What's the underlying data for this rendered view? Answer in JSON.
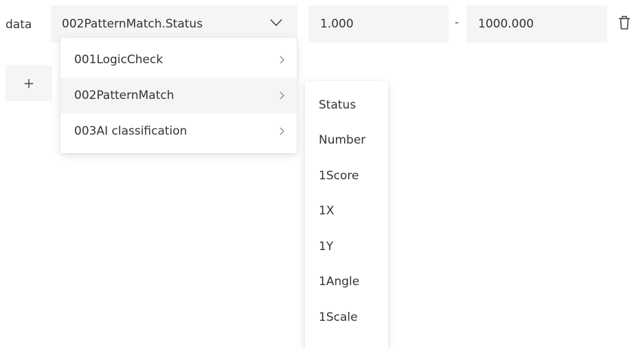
{
  "row": {
    "label": "data"
  },
  "select": {
    "value": "002PatternMatch.Status"
  },
  "range": {
    "min": "1.000",
    "separator": "-",
    "max": "1000.000"
  },
  "add_button": {
    "label": "+"
  },
  "menu": {
    "items": [
      {
        "label": "001LogicCheck"
      },
      {
        "label": "002PatternMatch"
      },
      {
        "label": "003AI classification"
      }
    ],
    "active_index": 1
  },
  "submenu": {
    "items": [
      {
        "label": "Status"
      },
      {
        "label": "Number"
      },
      {
        "label": "1Score"
      },
      {
        "label": "1X"
      },
      {
        "label": "1Y"
      },
      {
        "label": "1Angle"
      },
      {
        "label": "1Scale"
      }
    ]
  },
  "icons": {
    "select_chevron": "chevron-down-icon",
    "menu_arrow": "chevron-right-icon",
    "delete": "trash-icon"
  },
  "colors": {
    "field_background": "#f5f5f5",
    "active_item_background": "#f5f5f5",
    "text": "#333333"
  }
}
